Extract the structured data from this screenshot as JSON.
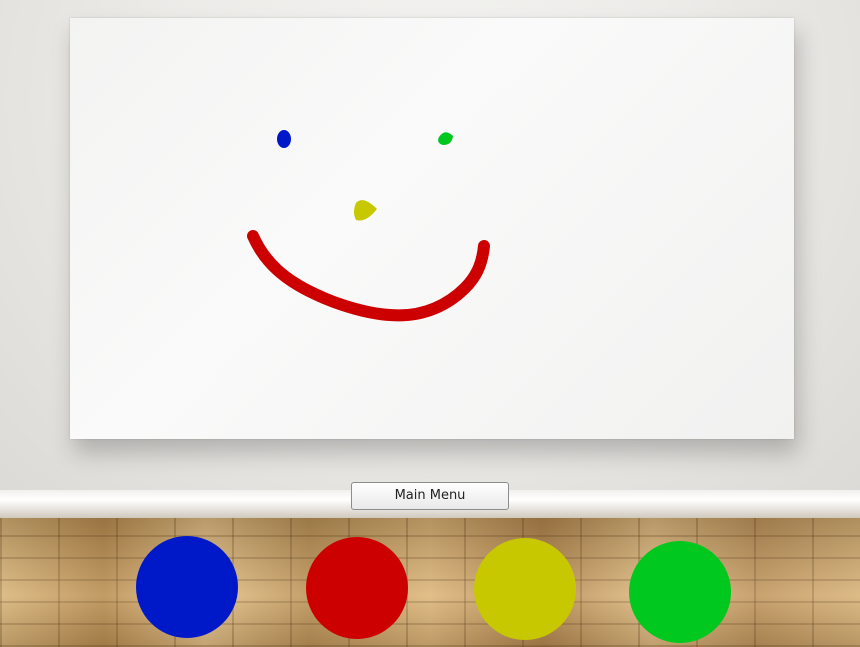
{
  "main_menu": {
    "label": "Main Menu"
  },
  "palette": [
    {
      "name": "blue",
      "color": "#0019c8"
    },
    {
      "name": "red",
      "color": "#cc0000"
    },
    {
      "name": "yellow",
      "color": "#c8c800"
    },
    {
      "name": "green",
      "color": "#00c81e"
    }
  ],
  "drawing": {
    "strokes": [
      {
        "feature": "left-eye",
        "color": "#0019c8"
      },
      {
        "feature": "right-eye",
        "color": "#00c81e"
      },
      {
        "feature": "nose",
        "color": "#c8c800"
      },
      {
        "feature": "mouth",
        "color": "#cc0000"
      }
    ]
  }
}
